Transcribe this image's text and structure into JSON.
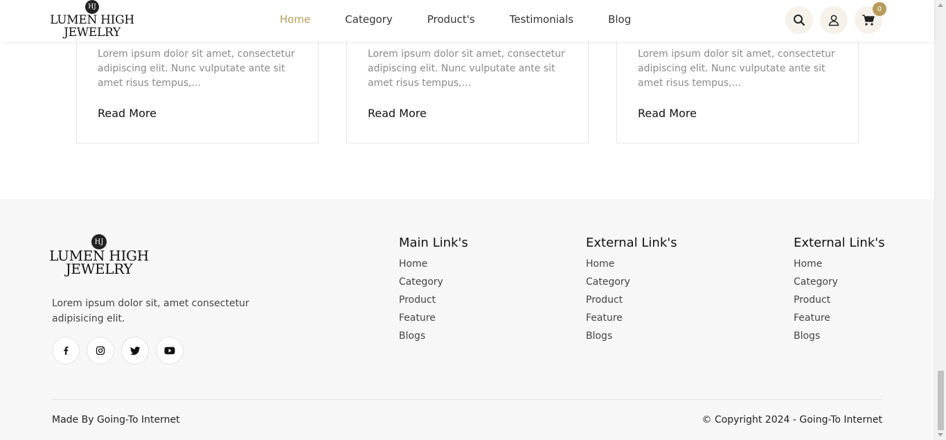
{
  "brand": {
    "monogram": "HJ",
    "line1": "LUMEN HIGH",
    "line2": "JEWELRY"
  },
  "nav": [
    {
      "label": "Home",
      "active": true
    },
    {
      "label": "Category",
      "active": false
    },
    {
      "label": "Product's",
      "active": false
    },
    {
      "label": "Testimonials",
      "active": false
    },
    {
      "label": "Blog",
      "active": false
    }
  ],
  "header_icons": {
    "search": "search-icon",
    "account": "user-icon",
    "cart": "cart-icon",
    "cart_count": "0"
  },
  "cards": [
    {
      "excerpt": "Lorem ipsum dolor sit amet, consectetur adipiscing elit. Nunc vulputate ante sit amet risus tempus,...",
      "read_more": "Read More"
    },
    {
      "excerpt": "Lorem ipsum dolor sit amet, consectetur adipiscing elit. Nunc vulputate ante sit amet risus tempus,...",
      "read_more": "Read More"
    },
    {
      "excerpt": "Lorem ipsum dolor sit amet, consectetur adipiscing elit. Nunc vulputate ante sit amet risus tempus,...",
      "read_more": "Read More"
    }
  ],
  "footer": {
    "description": "Lorem ipsum dolor sit, amet consectetur adipisicing elit.",
    "social": [
      "facebook-icon",
      "instagram-icon",
      "twitter-icon",
      "youtube-icon"
    ],
    "columns": [
      {
        "title": "Main Link's",
        "links": [
          "Home",
          "Category",
          "Product",
          "Feature",
          "Blogs"
        ]
      },
      {
        "title": "External Link's",
        "links": [
          "Home",
          "Category",
          "Product",
          "Feature",
          "Blogs"
        ]
      },
      {
        "title": "External Link's",
        "links": [
          "Home",
          "Category",
          "Product",
          "Feature",
          "Blogs"
        ]
      }
    ],
    "made_by": "Made By Going-To Internet",
    "copyright": "© Copyright 2024 - Going-To Internet"
  },
  "colors": {
    "accent": "#b79b5b",
    "footer_bg": "#f7f7f7",
    "icon_bg": "#f6f1ea"
  }
}
